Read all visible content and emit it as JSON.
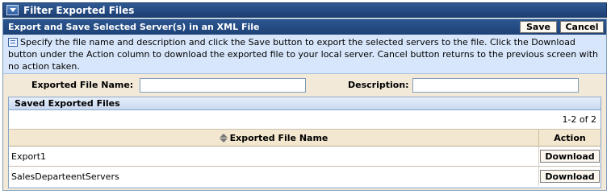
{
  "top_bar": {
    "title": "Filter Exported Files"
  },
  "panel": {
    "title": "Export and Save Selected Server(s) in an XML File",
    "save_label": "Save",
    "cancel_label": "Cancel",
    "info_text": "Specify the file name and description and click the Save button to export the selected servers to the file. Click the Download button under the Action column to download the exported file to your local server. Cancel button returns to the previous screen with no action taken."
  },
  "form": {
    "file_name_label": "Exported File Name:",
    "file_name_value": "",
    "description_label": "Description:",
    "description_value": ""
  },
  "saved_files": {
    "title": "Saved Exported Files",
    "pager": "1-2 of 2",
    "columns": {
      "name": "Exported File Name",
      "action": "Action"
    },
    "rows": [
      {
        "name": "Export1",
        "action_label": "Download"
      },
      {
        "name": "SalesDeparteentServers",
        "action_label": "Download"
      }
    ]
  }
}
